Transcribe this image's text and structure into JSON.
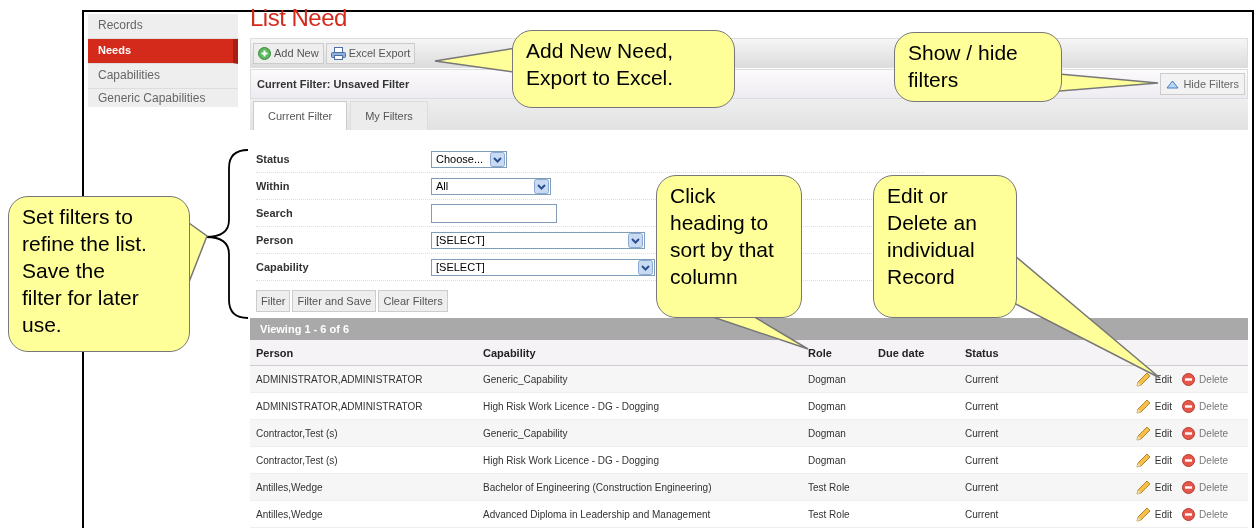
{
  "sidebar": {
    "items": [
      {
        "label": "Records",
        "selected": false
      },
      {
        "label": "Needs",
        "selected": true
      },
      {
        "label": "Capabilities",
        "selected": false
      },
      {
        "label": "Generic Capabilities",
        "selected": false
      }
    ]
  },
  "page_title": "List Need",
  "toolbar": {
    "buttons": [
      {
        "label": "Add New",
        "kind": "add"
      },
      {
        "label": "Excel Export",
        "kind": "export"
      }
    ]
  },
  "filter_bar": {
    "title": "Current Filter: Unsaved Filter",
    "toggle_button": "Hide Filters"
  },
  "tabs": [
    {
      "label": "Current Filter",
      "selected": true
    },
    {
      "label": "My Filters",
      "selected": false
    }
  ],
  "filters": [
    {
      "label": "Status",
      "kind": "select",
      "value": "Choose..."
    },
    {
      "label": "Within",
      "kind": "select",
      "value": "All"
    },
    {
      "label": "Search",
      "kind": "text"
    },
    {
      "label": "Person",
      "kind": "select",
      "value": "[SELECT]"
    },
    {
      "label": "Capability",
      "kind": "select",
      "value": "[SELECT]"
    }
  ],
  "filter_buttons": [
    "Filter",
    "Filter and Save",
    "Clear Filters"
  ],
  "results": {
    "summary": "Viewing 1 - 6 of 6",
    "columns": [
      "Person",
      "Capability",
      "Role",
      "Due date",
      "Status"
    ],
    "rows": [
      {
        "cells": [
          "ADMINISTRATOR,ADMINISTRATOR",
          "Generic_Capability",
          "Dogman",
          "",
          "Current"
        ],
        "actions": [
          "Edit",
          "Delete"
        ]
      },
      {
        "cells": [
          "ADMINISTRATOR,ADMINISTRATOR",
          "High Risk Work Licence - DG - Dogging",
          "Dogman",
          "",
          "Current"
        ],
        "actions": [
          "Edit",
          "Delete"
        ]
      },
      {
        "cells": [
          "Contractor,Test (s)",
          "Generic_Capability",
          "Dogman",
          "",
          "Current"
        ],
        "actions": [
          "Edit",
          "Delete"
        ]
      },
      {
        "cells": [
          "Contractor,Test (s)",
          "High Risk Work Licence - DG - Dogging",
          "Dogman",
          "",
          "Current"
        ],
        "actions": [
          "Edit",
          "Delete"
        ]
      },
      {
        "cells": [
          "Antilles,Wedge",
          "Bachelor of Engineering (Construction Engineering)",
          "Test Role",
          "",
          "Current"
        ],
        "actions": [
          "Edit",
          "Delete"
        ]
      },
      {
        "cells": [
          "Antilles,Wedge",
          "Advanced Diploma in Leadership and Management",
          "Test Role",
          "",
          "Current"
        ],
        "actions": [
          "Edit",
          "Delete"
        ]
      }
    ]
  },
  "callouts": [
    {
      "text": "Add New Need,\nExport to Excel."
    },
    {
      "text": "Show / hide\nfilters"
    },
    {
      "text": "Set filters to\nrefine the list.\nSave the\nfilter for later\nuse."
    },
    {
      "text": "Click\nheading to\nsort by that\ncolumn"
    },
    {
      "text": "Edit or\nDelete an\nindividual\nRecord"
    }
  ]
}
